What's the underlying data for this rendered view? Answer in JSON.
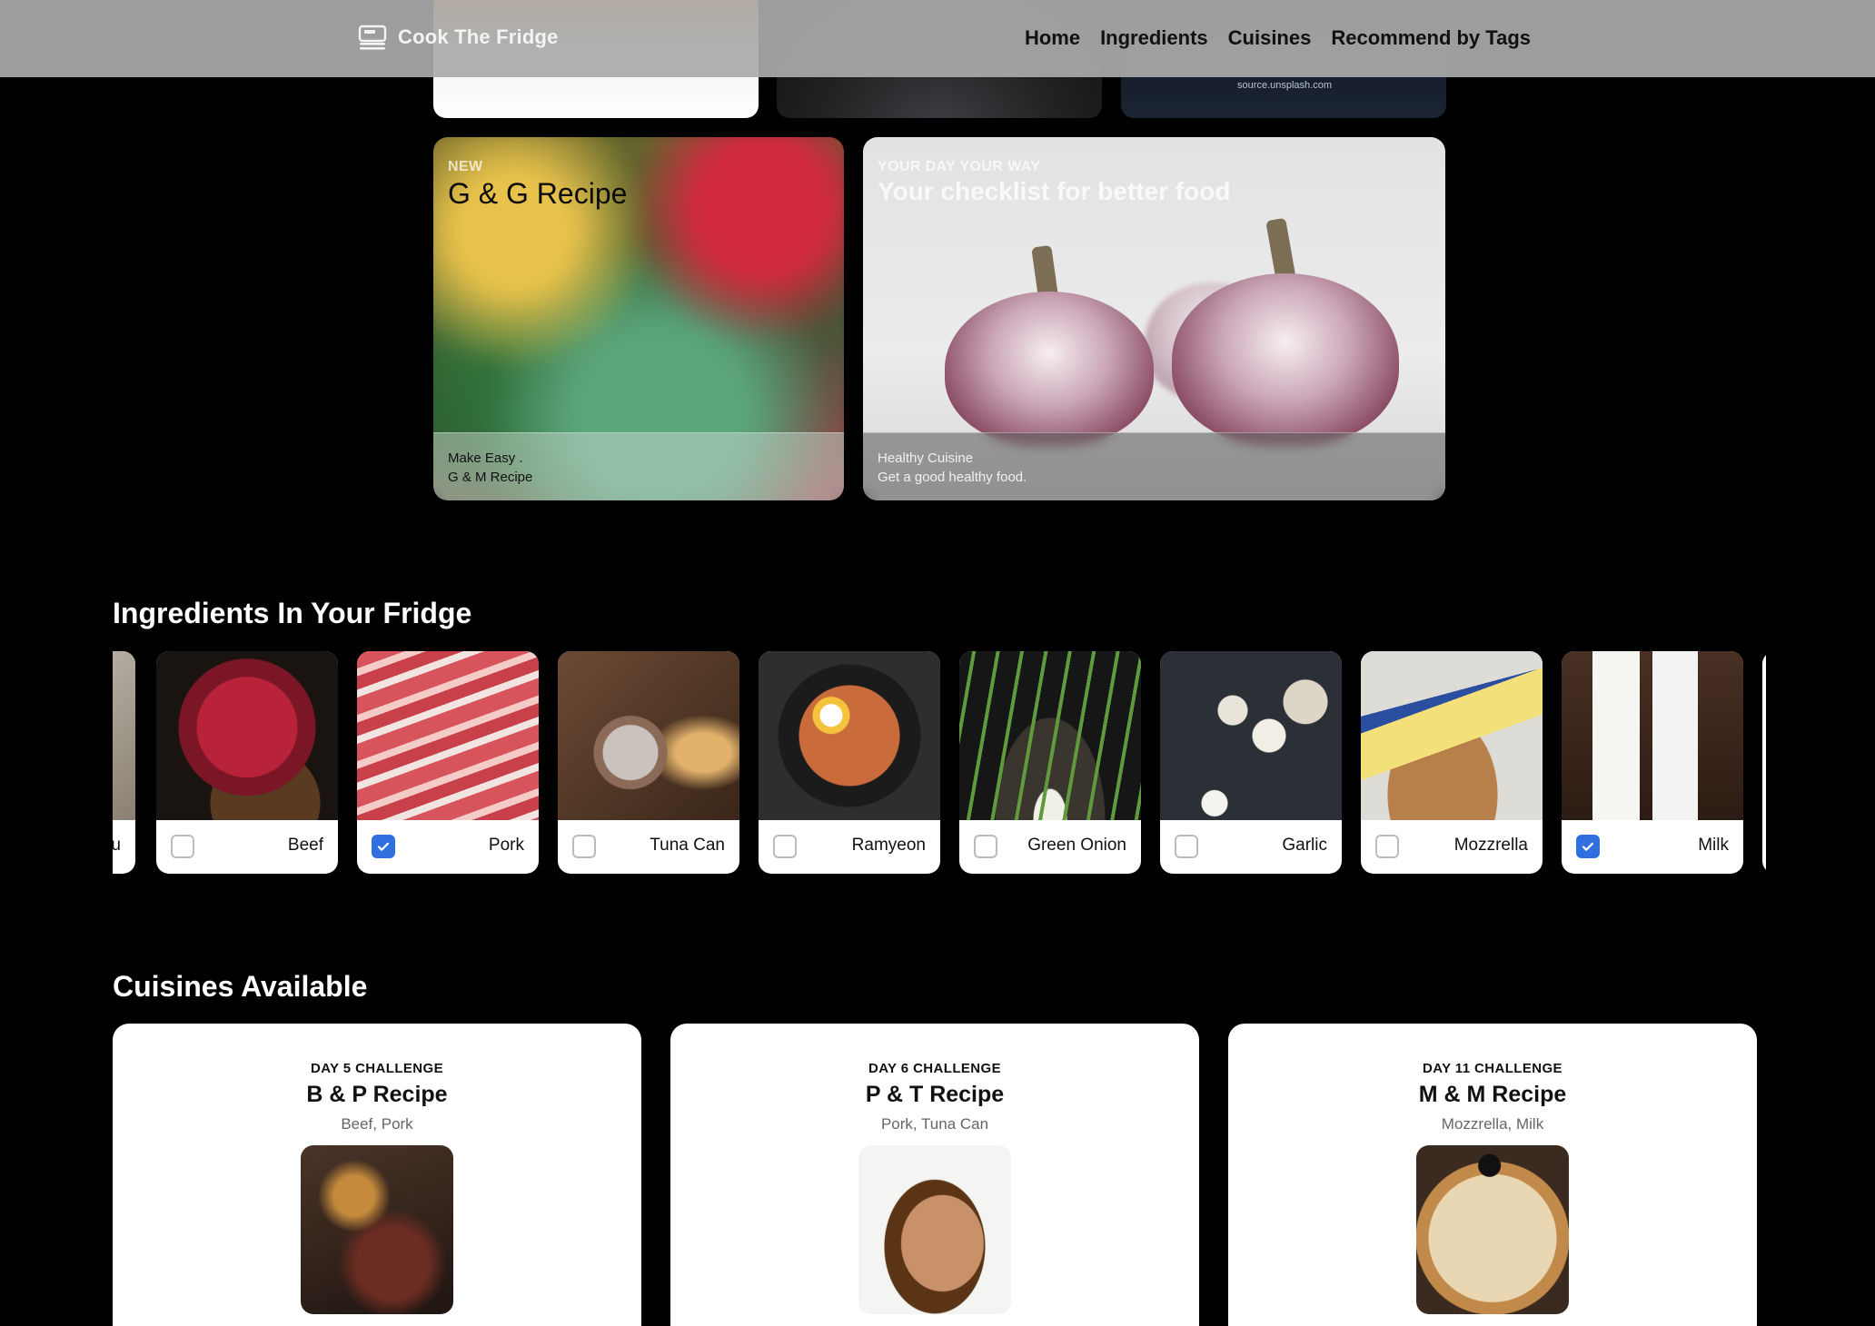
{
  "nav": {
    "brand": "Cook The Fridge",
    "links": [
      "Home",
      "Ingredients",
      "Cuisines",
      "Recommend by Tags"
    ]
  },
  "hero": {
    "credit": "source.unsplash.com",
    "cards": [
      {
        "eyebrow": "NEW",
        "title": "G & G Recipe",
        "line1": "Make Easy .",
        "line2": "G & M Recipe"
      },
      {
        "eyebrow": "YOUR DAY YOUR WAY",
        "title": "Your checklist for better food",
        "line1": "Healthy Cuisine",
        "line2": "Get a good healthy food."
      }
    ]
  },
  "ingredients_section": {
    "title": "Ingredients In Your Fridge",
    "partial_left_label": "u",
    "items": [
      {
        "name": "Beef",
        "checked": false
      },
      {
        "name": "Pork",
        "checked": true
      },
      {
        "name": "Tuna Can",
        "checked": false
      },
      {
        "name": "Ramyeon",
        "checked": false
      },
      {
        "name": "Green Onion",
        "checked": false
      },
      {
        "name": "Garlic",
        "checked": false
      },
      {
        "name": "Mozzrella",
        "checked": false
      },
      {
        "name": "Milk",
        "checked": true
      }
    ]
  },
  "cuisines_section": {
    "title": "Cuisines Available",
    "cards": [
      {
        "eyebrow": "DAY 5 CHALLENGE",
        "title": "B & P Recipe",
        "ingredients": "Beef, Pork"
      },
      {
        "eyebrow": "DAY 6 CHALLENGE",
        "title": "P & T Recipe",
        "ingredients": "Pork, Tuna Can"
      },
      {
        "eyebrow": "DAY 11 CHALLENGE",
        "title": "M & M Recipe",
        "ingredients": "Mozzrella, Milk"
      }
    ]
  },
  "colors": {
    "accent": "#2f6fe0",
    "background": "#000000",
    "card": "#ffffff"
  }
}
